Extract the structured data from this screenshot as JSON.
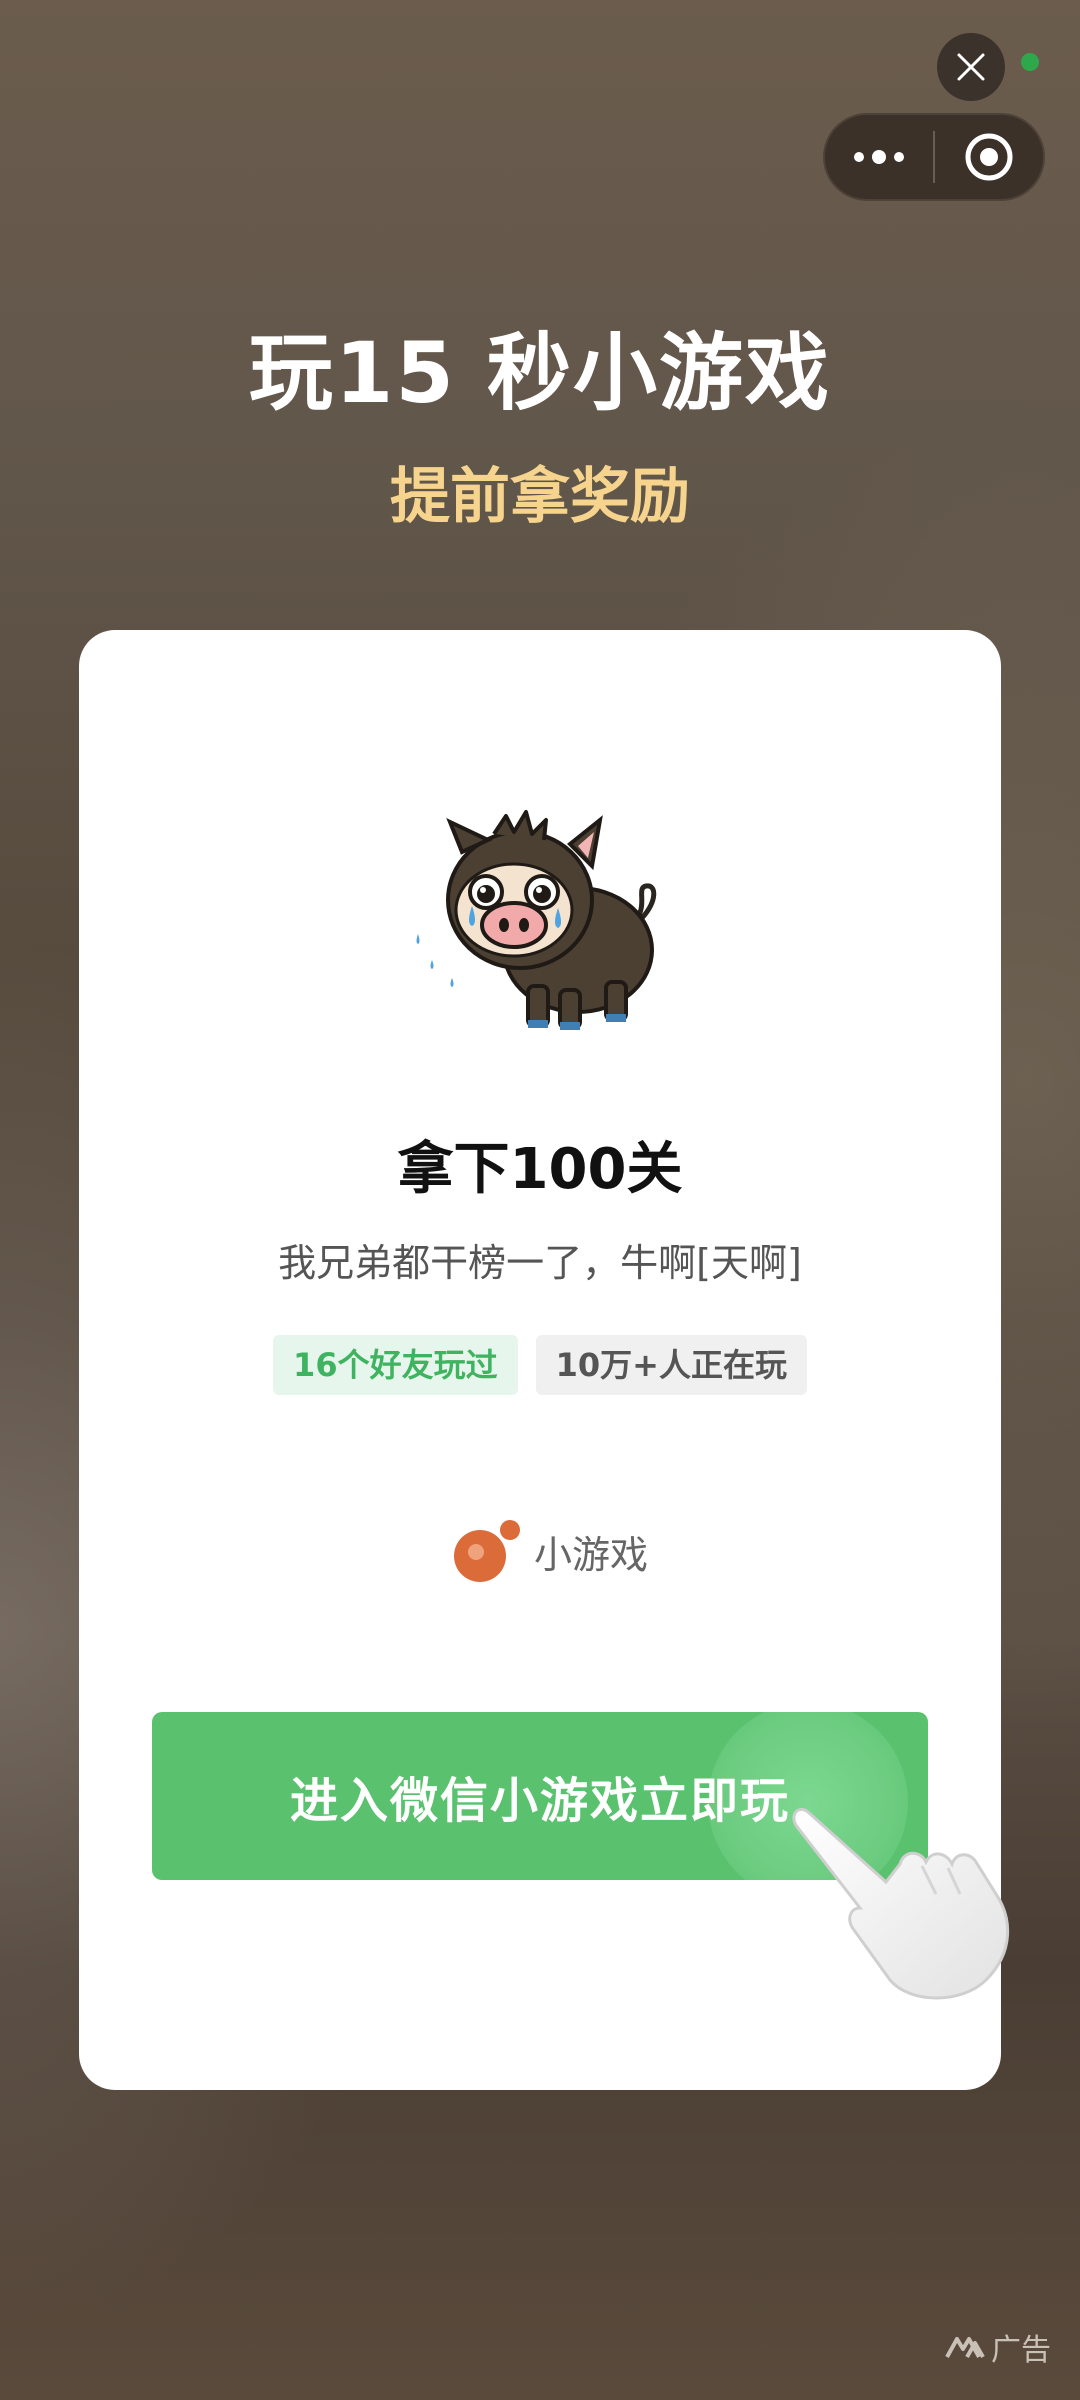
{
  "controls": {
    "close_icon": "close-icon",
    "more_icon": "more-dots-icon",
    "target_icon": "target-icon",
    "status_color": "#2fa84c"
  },
  "hero": {
    "headline": "玩15 秒小游戏",
    "subheadline": "提前拿奖励"
  },
  "game": {
    "icon": "crying-boar-icon",
    "title": "拿下100关",
    "description": "我兄弟都干榜一了，牛啊[天啊]",
    "tags": [
      {
        "label": "16个好友玩过"
      },
      {
        "label": "10万+人正在玩"
      }
    ]
  },
  "brand": {
    "label": "小游戏",
    "icon": "mini-game-logo-icon"
  },
  "cta": {
    "label": "进入微信小游戏立即玩",
    "color": "#5ac26e"
  },
  "ad": {
    "label": "广告"
  }
}
